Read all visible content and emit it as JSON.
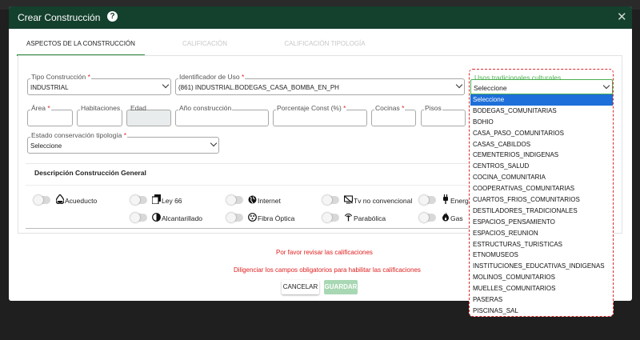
{
  "modal": {
    "title": "Crear Construcción",
    "close_symbol": "✕",
    "help_symbol": "?"
  },
  "tabs": [
    {
      "label": "ASPECTOS DE LA CONSTRUCCIÓN"
    },
    {
      "label": "CALIFICACIÓN"
    },
    {
      "label": "CALIFICACIÓN TIPOLOGÍA"
    }
  ],
  "form": {
    "tipo_construccion": {
      "label": "Tipo Construcción",
      "value": "INDUSTRIAL",
      "required": "*"
    },
    "identificador_uso": {
      "label": "Identificador de Uso",
      "value": "(861) INDUSTRIAL.BODEGAS_CASA_BOMBA_EN_PH",
      "required": "*"
    },
    "usos_tradicionales": {
      "label": "Usos tradicionales culturales",
      "value": "Seleccione"
    },
    "area": {
      "label": "Área",
      "required": "*",
      "value": ""
    },
    "habitaciones": {
      "label": "Habitaciones",
      "value": ""
    },
    "edad": {
      "label": "Edad",
      "value": ""
    },
    "anio_construccion": {
      "label": "Año construcción",
      "value": ""
    },
    "porcentaje_const": {
      "label": "Porcentaje Const (%)",
      "required": "*",
      "value": ""
    },
    "cocinas": {
      "label": "Cocinas",
      "required": "*",
      "value": ""
    },
    "pisos": {
      "label": "Pisos",
      "value": ""
    },
    "estado_conservacion": {
      "label": "Estado conservación tipología",
      "value": "Seleccione",
      "required": "*"
    }
  },
  "section": {
    "title": "Descripción Construcción General"
  },
  "services": [
    {
      "label": "Acueducto",
      "icon": "water-drop-icon"
    },
    {
      "label": "Ley 66",
      "icon": "documents-icon"
    },
    {
      "label": "Internet",
      "icon": "globe-icon"
    },
    {
      "label": "Tv no convencional",
      "icon": "tv-off-icon"
    },
    {
      "label": "Energía",
      "icon": "plug-icon"
    },
    {
      "label": "Alcantarillado",
      "icon": "half-circle-icon"
    },
    {
      "label": "Fibra Óptica",
      "icon": "fiber-icon"
    },
    {
      "label": "Parabólica",
      "icon": "antenna-icon"
    },
    {
      "label": "Gas",
      "icon": "flame-icon"
    }
  ],
  "messages": {
    "revisar": "Por favor revisar las calificaciones",
    "diligenciar": "Diligenciar los campos obligatorios para habilitar las calificaciones"
  },
  "buttons": {
    "cancel": "CANCELAR",
    "save": "GUARDAR"
  },
  "usos_options": [
    "Seleccione",
    "BODEGAS_COMUNITARIAS",
    "BOHIO",
    "CASA_PASO_COMUNITARIOS",
    "CASAS_CABILDOS",
    "CEMENTERIOS_INDIGENAS",
    "CENTROS_SALUD",
    "COCINA_COMUNITARIA",
    "COOPERATIVAS_COMUNITARIAS",
    "CUARTOS_FRIOS_COMUNITARIOS",
    "DESTILADORES_TRADICIONALES",
    "ESPACIOS_PENSAMIENTO",
    "ESPACIOS_REUNION",
    "ESTRUCTURAS_TURISTICAS",
    "ETNOMUSEOS",
    "INSTITUCIONES_EDUCATIVAS_INDIGENAS",
    "MOLINOS_COMUNITARIOS",
    "MUELLES_COMUNITARIOS",
    "PASERAS",
    "PISCINAS_SAL"
  ],
  "colors": {
    "header": "#14402e",
    "accent": "#2d8a3e",
    "error": "#e02020",
    "selected": "#1e6fd9"
  }
}
